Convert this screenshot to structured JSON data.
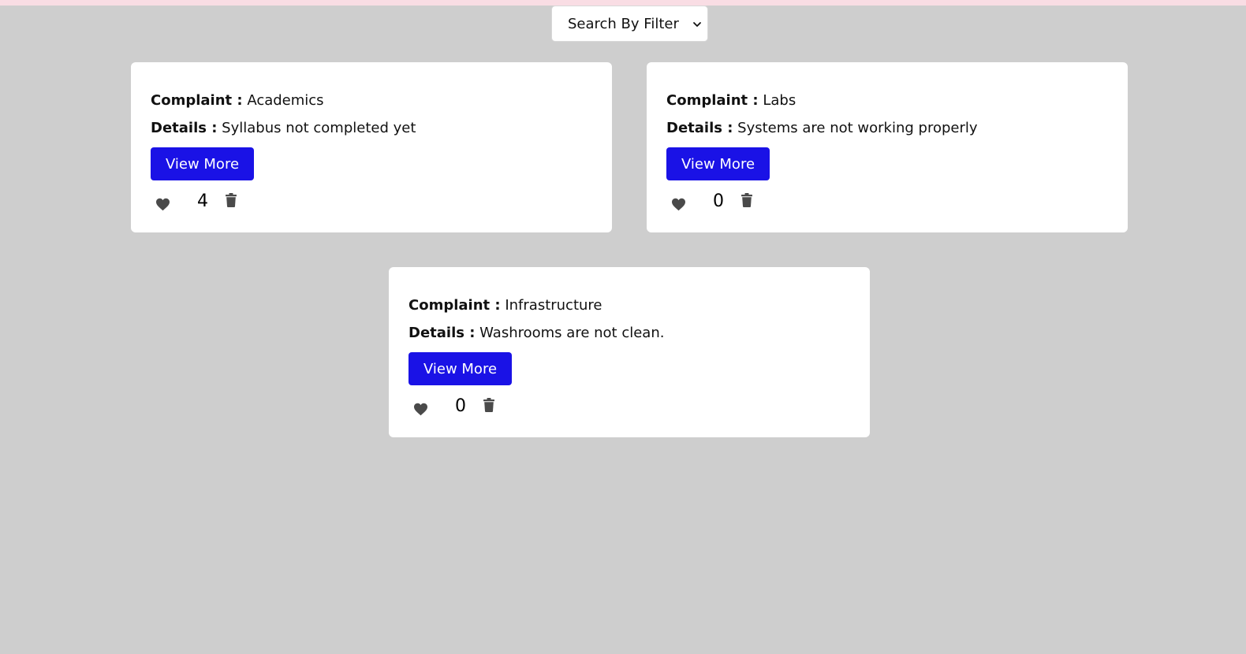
{
  "filter": {
    "selected": "Search By Filter"
  },
  "labels": {
    "complaint": "Complaint :",
    "details": "Details :",
    "view_more": "View More"
  },
  "cards": [
    {
      "complaint": "Academics",
      "details": "Syllabus not completed yet",
      "likes": "4"
    },
    {
      "complaint": "Labs",
      "details": "Systems are not working properly",
      "likes": "0"
    },
    {
      "complaint": "Infrastructure",
      "details": "Washrooms are not clean.",
      "likes": "0"
    }
  ],
  "colors": {
    "page_background": "#cecece",
    "top_strip": "#f9dde4",
    "card_background": "#ffffff",
    "button": "#1a12e6",
    "icon": "#4a4a4a"
  },
  "icons": {
    "filter": "chevron-down-icon",
    "like": "heart-icon",
    "delete": "trash-icon"
  }
}
